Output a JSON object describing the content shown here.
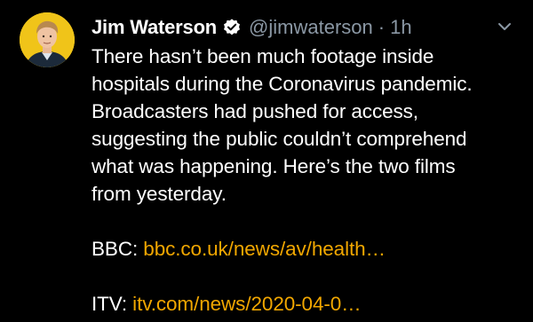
{
  "tweet": {
    "display_name": "Jim Waterson",
    "handle": "@jimwaterson",
    "separator": "·",
    "time": "1h",
    "avatar_icon": "user-avatar-photo",
    "verified_icon": "verified-badge-icon",
    "menu_icon": "chevron-down-icon",
    "text_lines": [
      "There hasn’t been much footage inside",
      "hospitals during the Coronavirus pandemic.",
      "Broadcasters had pushed for access,",
      "suggesting the public couldn’t comprehend",
      "what was happening. Here’s the two films",
      "from yesterday."
    ],
    "links": [
      {
        "label": "BBC:",
        "url_text": "bbc.co.uk/news/av/health…"
      },
      {
        "label": "ITV:",
        "url_text": "itv.com/news/2020-04-0…"
      }
    ]
  },
  "colors": {
    "background": "#000000",
    "text": "#ffffff",
    "muted": "#8b98a5",
    "link": "#f2a700",
    "avatar_bg": "#f0c419"
  }
}
